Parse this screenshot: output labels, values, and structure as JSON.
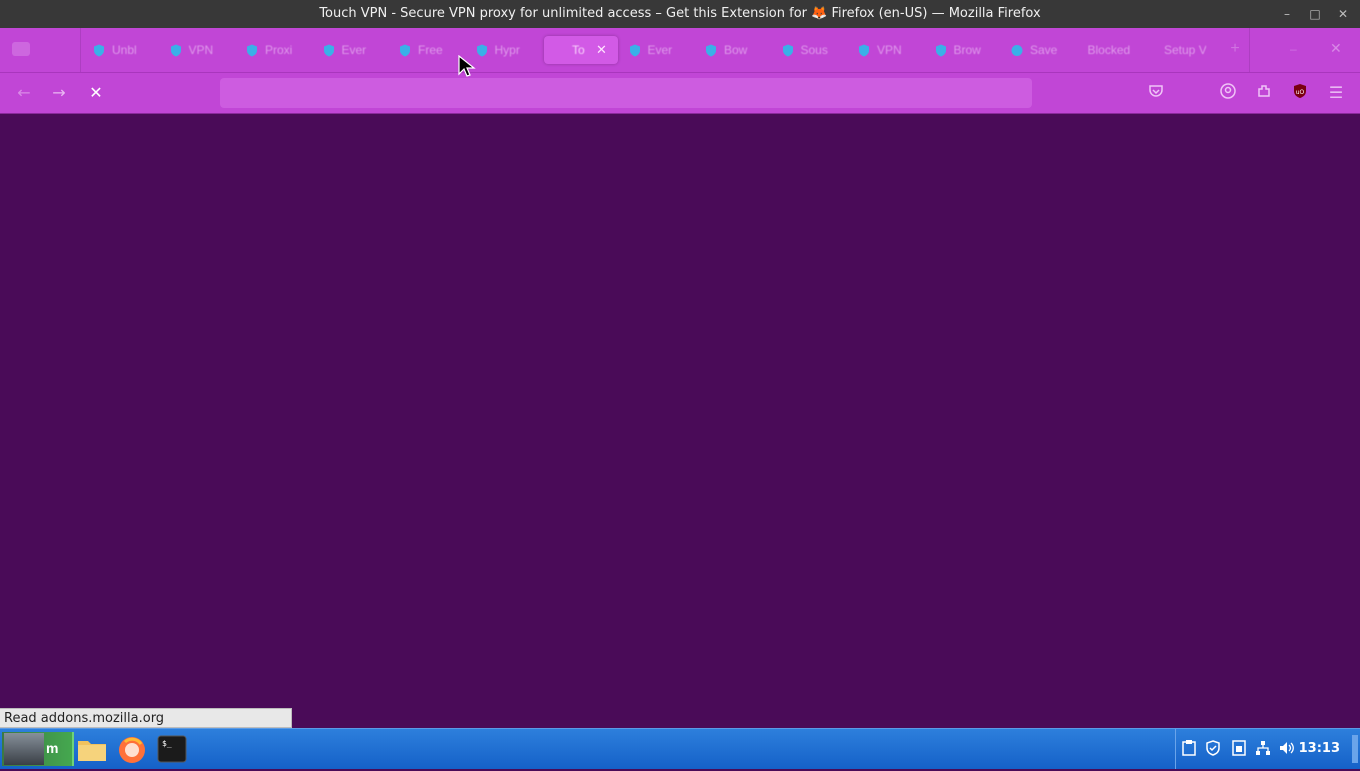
{
  "window": {
    "title": "Touch VPN - Secure VPN proxy for unlimited access – Get this Extension for 🦊 Firefox (en-US) — Mozilla Firefox",
    "controls": {
      "minimize": "–",
      "maximize": "□",
      "close": "✕"
    }
  },
  "tabs": [
    {
      "label": "Unbl",
      "icon": "shield-favicon",
      "active": false
    },
    {
      "label": "VPN",
      "icon": "shield-favicon",
      "active": false
    },
    {
      "label": "Proxi",
      "icon": "shield-favicon",
      "active": false
    },
    {
      "label": "Ever",
      "icon": "shield-favicon",
      "active": false
    },
    {
      "label": "Free",
      "icon": "shield-favicon",
      "active": false
    },
    {
      "label": "Hypr",
      "icon": "shield-favicon",
      "active": false
    },
    {
      "label": "To",
      "icon": "none",
      "active": true,
      "close": "✕"
    },
    {
      "label": "Ever",
      "icon": "shield-favicon",
      "active": false
    },
    {
      "label": "Bow",
      "icon": "shield-favicon",
      "active": false
    },
    {
      "label": "Sous",
      "icon": "shield-favicon",
      "active": false
    },
    {
      "label": "VPN",
      "icon": "shield-favicon",
      "active": false
    },
    {
      "label": "Brow",
      "icon": "shield-favicon",
      "active": false
    },
    {
      "label": "Save",
      "icon": "circle-favicon",
      "active": false
    },
    {
      "label": "Blocked",
      "icon": "none",
      "active": false
    },
    {
      "label": "Setup VI",
      "icon": "none",
      "active": false
    }
  ],
  "navbar": {
    "back": "←",
    "forward": "→",
    "stop": "✕",
    "url_value": "",
    "pocket": "pocket-icon",
    "account": "account-icon",
    "extensions": "extensions-icon",
    "ublock": "uO",
    "menu": "☰"
  },
  "status": {
    "text": "Read addons.mozilla.org"
  },
  "taskbar": {
    "start_label": "m",
    "clock": "13:13",
    "apps": [
      "file-manager-icon",
      "firefox-icon",
      "terminal-icon"
    ],
    "tray": [
      "clipboard-icon",
      "shield-icon",
      "battery-icon",
      "network-icon",
      "volume-icon"
    ]
  },
  "colors": {
    "chrome": "#c146d6",
    "content": "#4a0b58",
    "taskbar": "#1f6fd4",
    "favicon": "#3ab0e8"
  }
}
